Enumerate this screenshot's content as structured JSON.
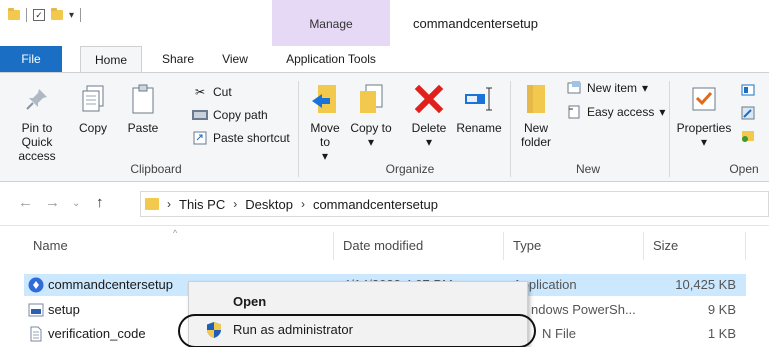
{
  "title_bar": {
    "manage_label": "Manage",
    "window_title": "commandcentersetup"
  },
  "tabs": {
    "file": "File",
    "home": "Home",
    "share": "Share",
    "view": "View",
    "application_tools": "Application Tools"
  },
  "ribbon": {
    "clipboard": {
      "pin": "Pin to Quick access",
      "copy": "Copy",
      "paste": "Paste",
      "cut": "Cut",
      "copy_path": "Copy path",
      "paste_shortcut": "Paste shortcut",
      "label": "Clipboard"
    },
    "organize": {
      "move_to": "Move to",
      "copy_to": "Copy to",
      "delete": "Delete",
      "rename": "Rename",
      "label": "Organize"
    },
    "new": {
      "new_folder": "New folder",
      "new_item": "New item",
      "easy_access": "Easy access",
      "label": "New"
    },
    "open": {
      "properties": "Properties",
      "label": "Open"
    }
  },
  "address": {
    "crumbs": [
      "This PC",
      "Desktop",
      "commandcentersetup"
    ]
  },
  "columns": {
    "name": "Name",
    "date_modified": "Date modified",
    "type": "Type",
    "size": "Size"
  },
  "files": [
    {
      "name": "commandcentersetup",
      "date": "4/14/2023 4:07 PM",
      "type": "Application",
      "size": "10,425 KB"
    },
    {
      "name": "setup",
      "date": "",
      "type": "ndows PowerSh...",
      "size": "9 KB"
    },
    {
      "name": "verification_code",
      "date": "",
      "type": "N File",
      "size": "1 KB"
    }
  ],
  "context_menu": {
    "open": "Open",
    "run_as_admin": "Run as administrator"
  },
  "colors": {
    "file_tab": "#1a6fc4",
    "manage": "#e6d9f5",
    "selection": "#cce8ff"
  }
}
